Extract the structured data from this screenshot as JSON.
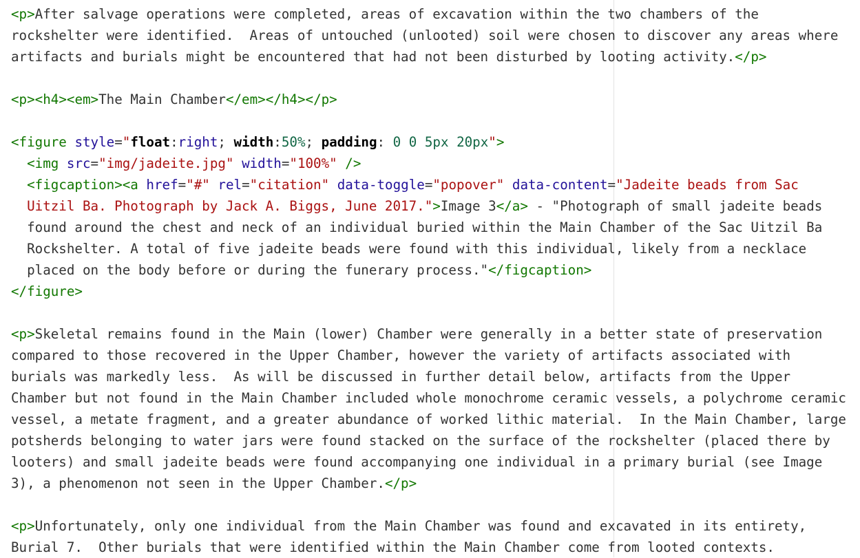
{
  "editor": {
    "lines": [
      "<p>After salvage operations were completed, areas of excavation within the two chambers of the",
      "rockshelter were identified.  Areas of untouched (unlooted) soil were chosen to discover any areas where",
      "artifacts and burials might be encountered that had not been disturbed by looting activity.</p>",
      "",
      "<p><h4><em>The Main Chamber</em></h4></p>",
      "",
      "<figure style=\"float:right; width:50%; padding: 0 0 5px 20px\">",
      "  <img src=\"img/jadeite.jpg\" width=\"100%\" />",
      "  <figcaption><a href=\"#\" rel=\"citation\" data-toggle=\"popover\" data-content=\"Jadeite beads from Sac",
      "  Uitzil Ba. Photograph by Jack A. Biggs, June 2017.\">Image 3</a> - \"Photograph of small jadeite beads",
      "  found around the chest and neck of an individual buried within the Main Chamber of the Sac Uitzil Ba",
      "  Rockshelter. A total of five jadeite beads were found with this individual, likely from a necklace",
      "  placed on the body before or during the funerary process.\"</figcaption>",
      "</figure>",
      "",
      "<p>Skeletal remains found in the Main (lower) Chamber were generally in a better state of preservation",
      "compared to those recovered in the Upper Chamber, however the variety of artifacts associated with",
      "burials was markedly less.  As will be discussed in further detail below, artifacts from the Upper",
      "Chamber but not found in the Main Chamber included whole monochrome ceramic vessels, a polychrome ceramic",
      "vessel, a metate fragment, and a greater abundance of worked lithic material.  In the Main Chamber, large",
      "potsherds belonging to water jars were found stacked on the surface of the rockshelter (placed there by",
      "looters) and small jadeite beads were found accompanying one individual in a primary burial (see Image",
      "3), a phenomenon not seen in the Upper Chamber.</p>",
      "",
      "<p>Unfortunately, only one individual from the Main Chamber was found and excavated in its entirety,",
      "Burial 7.  Other burials that were identified within the Main Chamber come from looted contexts."
    ]
  },
  "colors": {
    "tag": "#117700",
    "attribute": "#221199",
    "string": "#aa1111",
    "number": "#116644",
    "text": "#333333",
    "ruler": "#e2e2e2"
  }
}
